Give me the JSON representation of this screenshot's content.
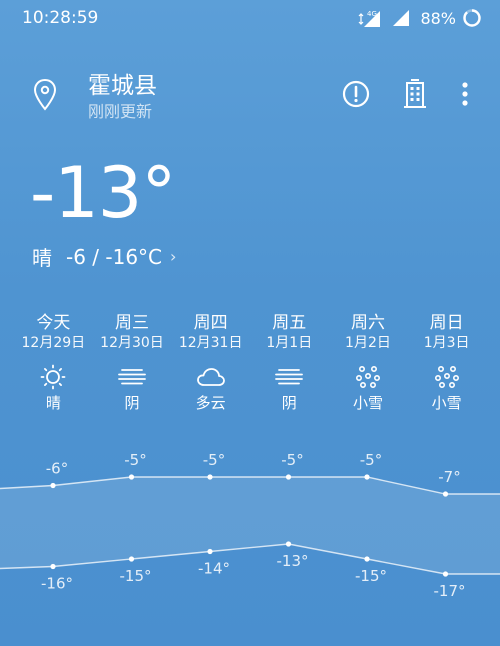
{
  "status": {
    "time": "10:28:59",
    "network": "4G",
    "battery": "88%"
  },
  "header": {
    "city": "霍城县",
    "updated": "刚刚更新",
    "icons": [
      "location-pin-icon",
      "alert-circle-icon",
      "city-building-icon",
      "more-vert-icon"
    ]
  },
  "current": {
    "temp": "-13°",
    "condition": "晴",
    "range": "-6 / -16°C",
    "chevron": "›"
  },
  "forecast": [
    {
      "name": "今天",
      "date": "12月29日",
      "cond": "晴",
      "icon": "sun",
      "high": "-6°",
      "low": "-16°",
      "high_v": -6,
      "low_v": -16
    },
    {
      "name": "周三",
      "date": "12月30日",
      "cond": "阴",
      "icon": "overcast",
      "high": "-5°",
      "low": "-15°",
      "high_v": -5,
      "low_v": -15
    },
    {
      "name": "周四",
      "date": "12月31日",
      "cond": "多云",
      "icon": "cloud",
      "high": "-5°",
      "low": "-14°",
      "high_v": -5,
      "low_v": -14
    },
    {
      "name": "周五",
      "date": "1月1日",
      "cond": "阴",
      "icon": "overcast",
      "high": "-5°",
      "low": "-13°",
      "high_v": -5,
      "low_v": -13
    },
    {
      "name": "周六",
      "date": "1月2日",
      "cond": "小雪",
      "icon": "snow",
      "high": "-5°",
      "low": "-15°",
      "high_v": -5,
      "low_v": -15
    },
    {
      "name": "周日",
      "date": "1月3日",
      "cond": "小雪",
      "icon": "snow",
      "high": "-7°",
      "low": "-17°",
      "high_v": -7,
      "low_v": -17
    }
  ]
}
